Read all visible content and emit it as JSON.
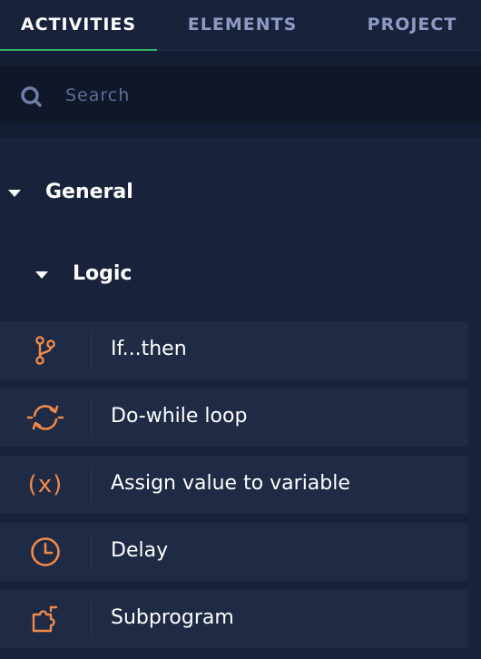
{
  "tabs": [
    {
      "label": "ACTIVITIES",
      "active": true
    },
    {
      "label": "ELEMENTS",
      "active": false
    },
    {
      "label": "PROJECT",
      "active": false
    }
  ],
  "search": {
    "placeholder": "Search",
    "value": ""
  },
  "tree": {
    "general": {
      "label": "General",
      "expanded": true
    },
    "logic": {
      "label": "Logic",
      "expanded": true
    }
  },
  "activities": [
    {
      "label": "If...then",
      "icon": "branch-icon"
    },
    {
      "label": "Do-while loop",
      "icon": "loop-icon"
    },
    {
      "label": "Assign value to variable",
      "icon": "variable-icon",
      "glyph": "(x)"
    },
    {
      "label": "Delay",
      "icon": "clock-icon"
    },
    {
      "label": "Subprogram",
      "icon": "puzzle-icon"
    }
  ],
  "colors": {
    "background": "#18223a",
    "row": "#1f2a44",
    "accent_green": "#35b66a",
    "icon_orange": "#f08a4b",
    "tab_inactive": "#8d9ac4"
  }
}
